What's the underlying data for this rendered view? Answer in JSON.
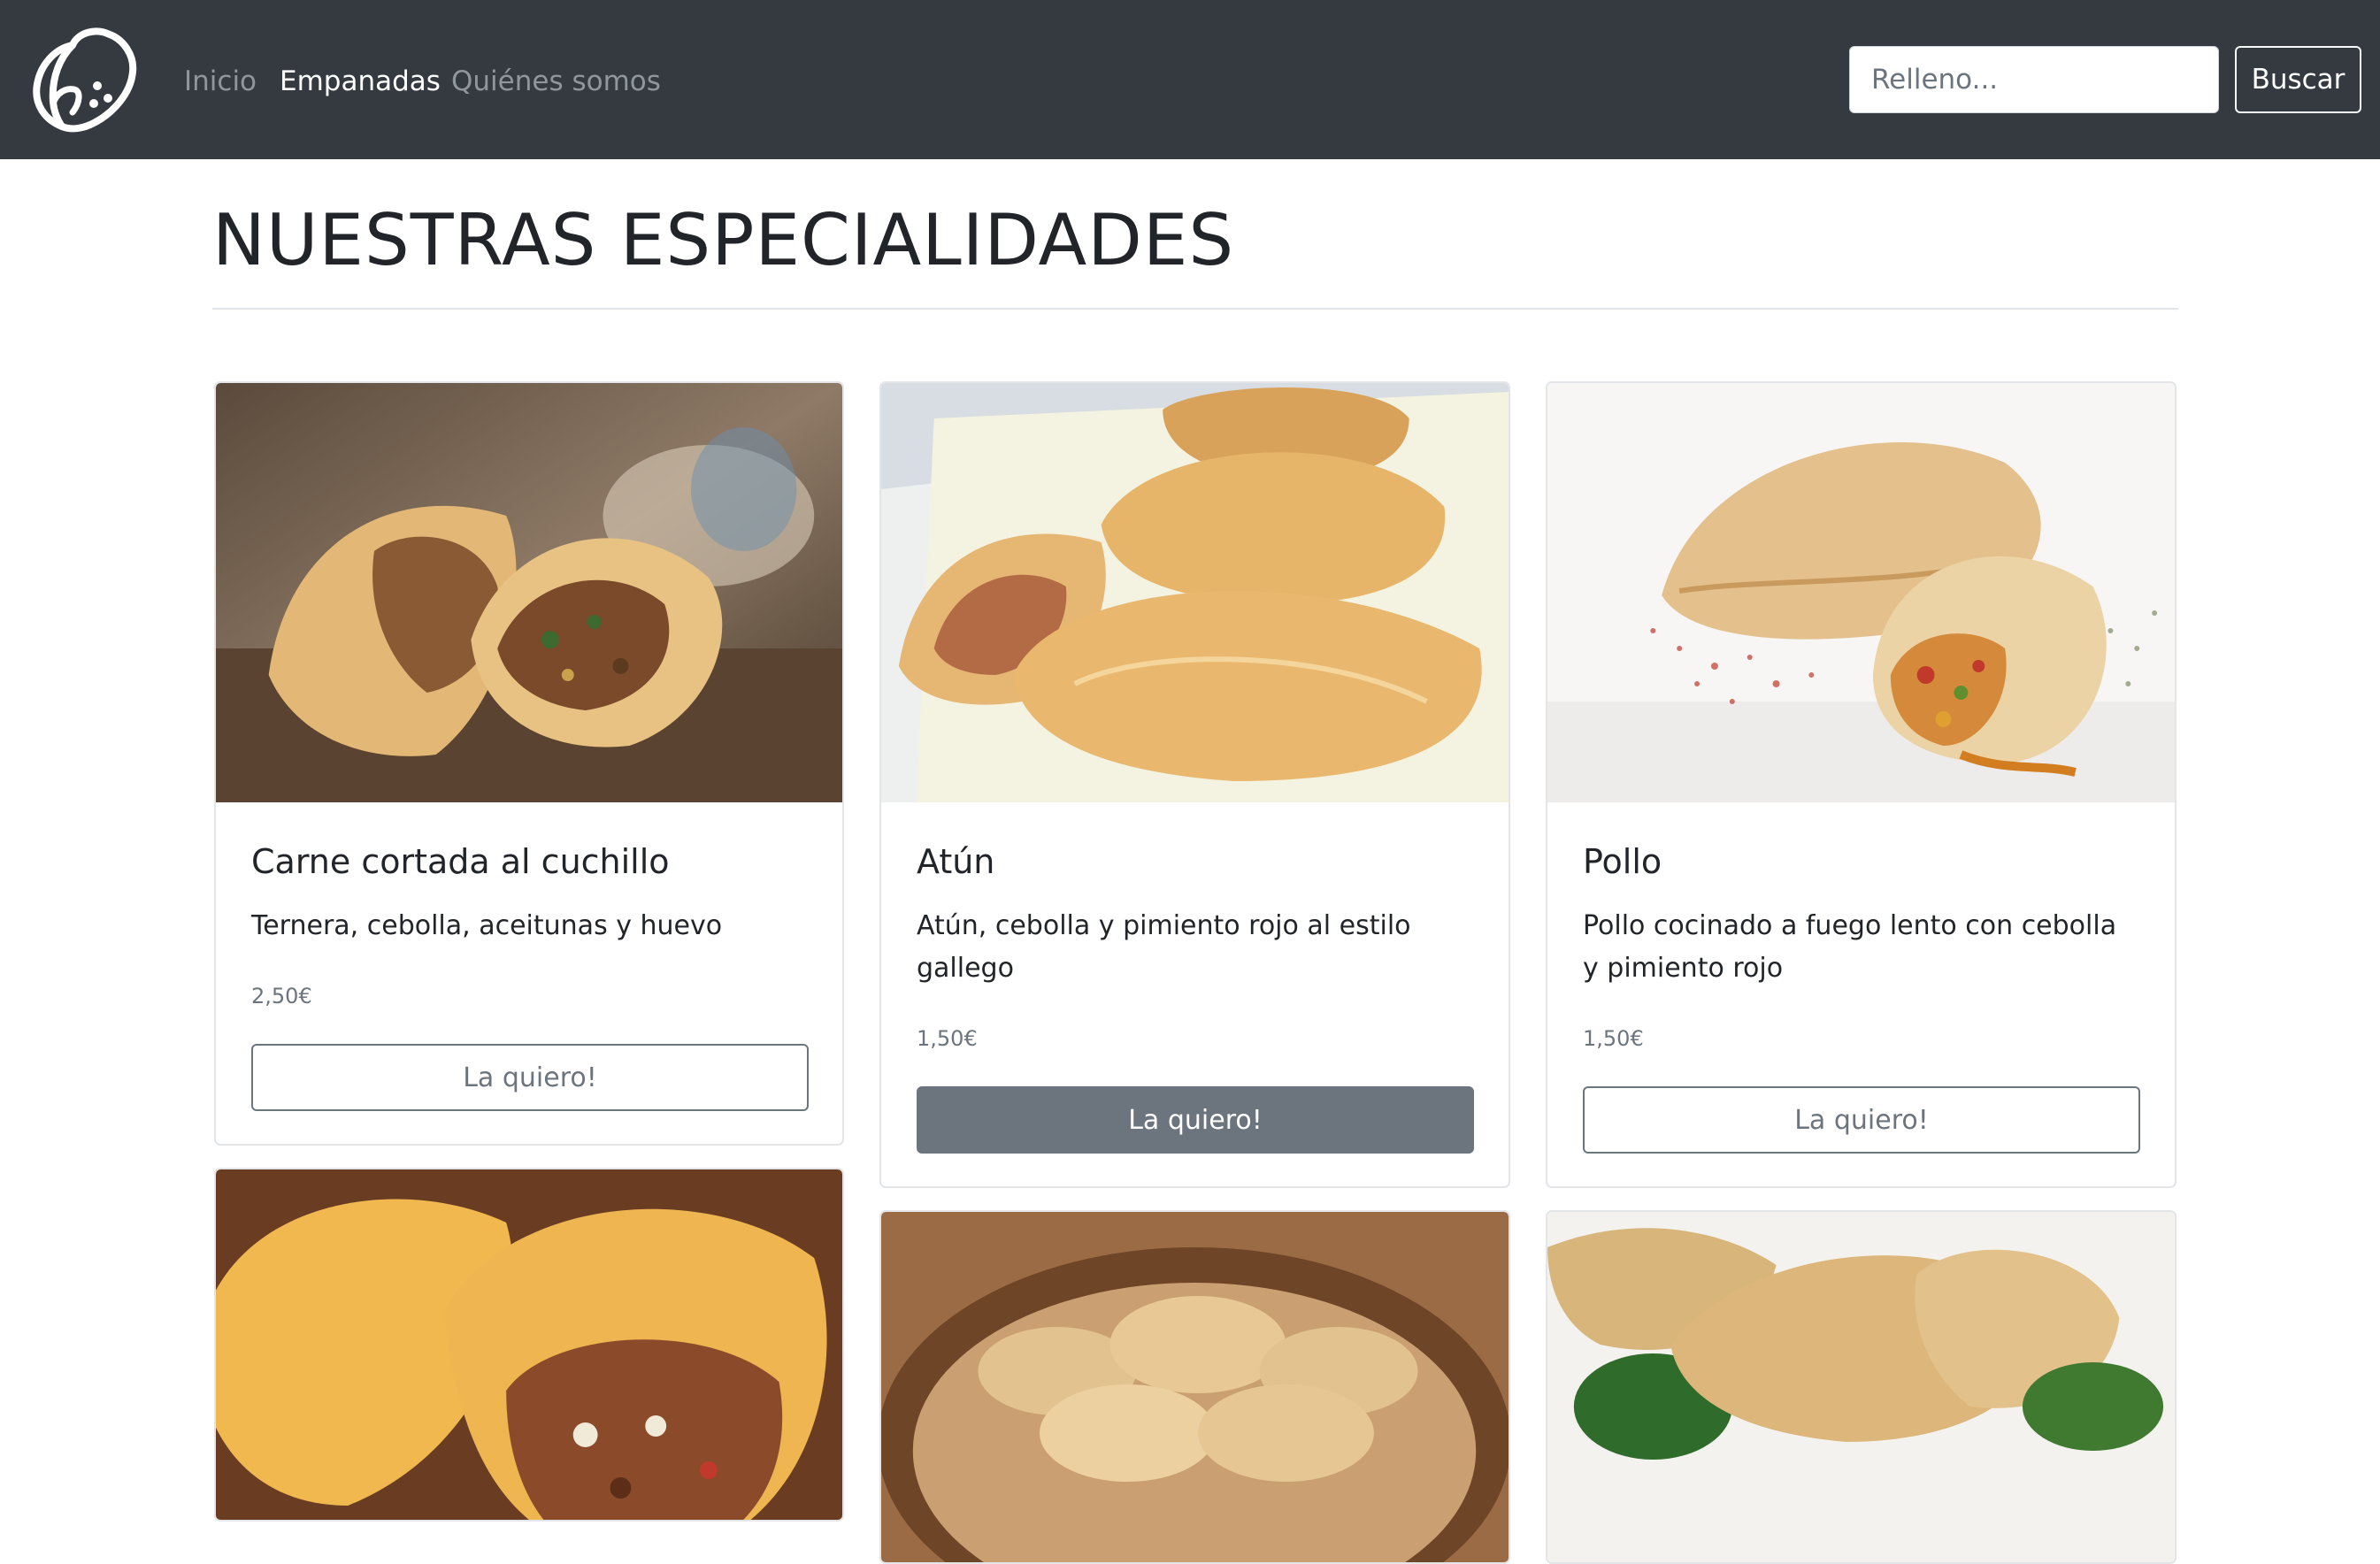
{
  "nav": {
    "brand_icon": "empanada-logo-icon",
    "links": [
      {
        "label": "Inicio"
      },
      {
        "label": "Empanadas"
      },
      {
        "label": "Quiénes somos"
      }
    ],
    "search_placeholder": "Relleno...",
    "search_button": "Buscar"
  },
  "main": {
    "title": "NUESTRAS ESPECIALIDADES",
    "cards": [
      {
        "title": "Carne cortada al cuchillo",
        "description": "Ternera, cebolla, aceitunas y huevo",
        "price": "2,50€",
        "button": "La quiero!"
      },
      {
        "title": "Atún",
        "description": "Atún, cebolla y pimiento rojo al estilo gallego",
        "price": "1,50€",
        "button": "La quiero!"
      },
      {
        "title": "Pollo",
        "description": "Pollo cocinado a fuego lento con cebolla y pimiento rojo",
        "price": "1,50€",
        "button": "La quiero!"
      }
    ]
  },
  "colors": {
    "navbar": "#343a40",
    "button_secondary": "#6c757d"
  }
}
